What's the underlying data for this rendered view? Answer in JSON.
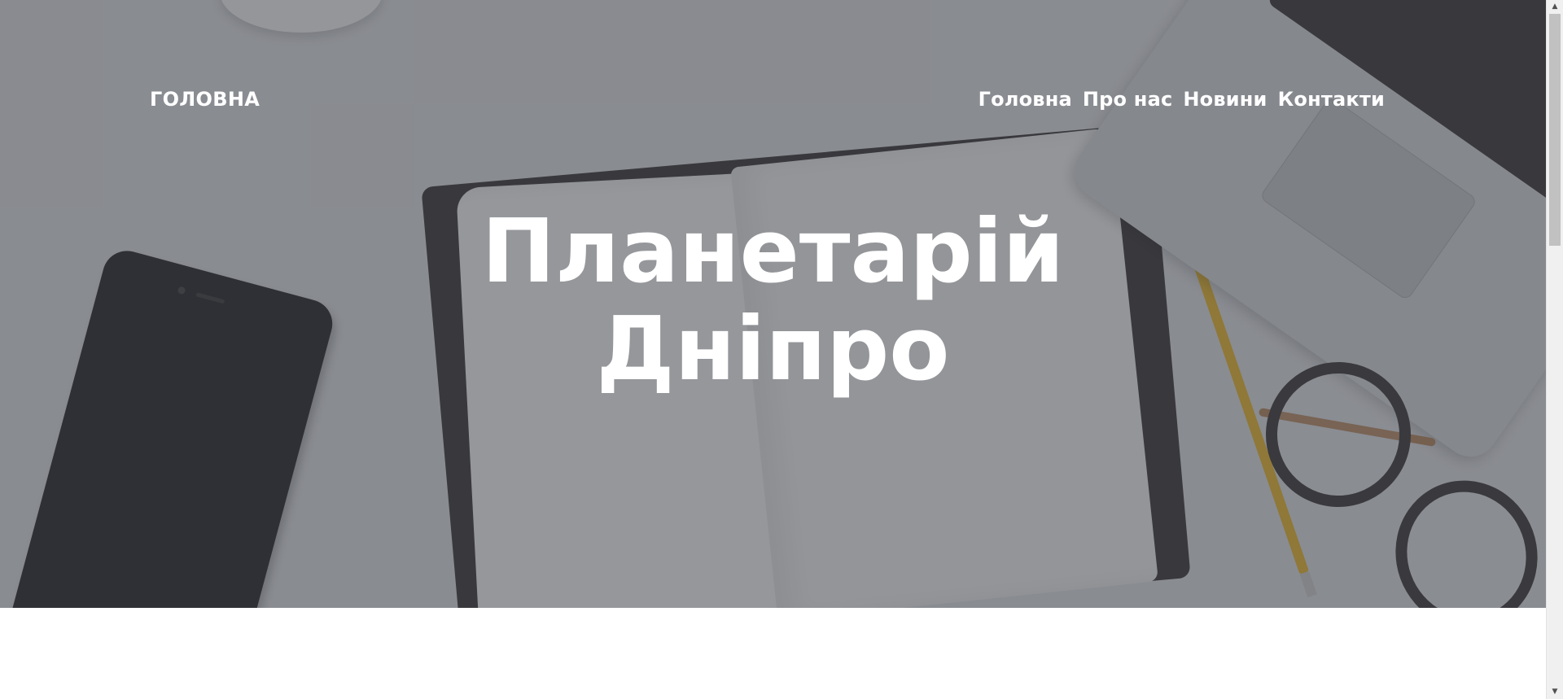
{
  "header": {
    "brand": "ГОЛОВНА",
    "nav": [
      {
        "label": "Головна"
      },
      {
        "label": "Про нас"
      },
      {
        "label": "Новини"
      },
      {
        "label": "Контакти"
      }
    ]
  },
  "hero": {
    "title_line1": "Планетарій",
    "title_line2": "Дніпро"
  },
  "scrollbar": {
    "up_icon": "▲",
    "down_icon": "▼"
  },
  "colors": {
    "hero_overlay": "#5f6169",
    "text": "#ffffff"
  }
}
